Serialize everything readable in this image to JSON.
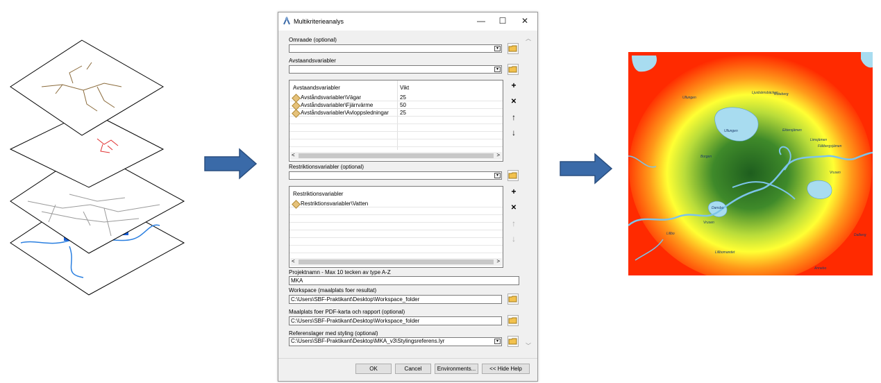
{
  "dialog": {
    "title": "Multikriterieanalys",
    "window_buttons": {
      "minimize": "—",
      "maximize": "☐",
      "close": "✕"
    },
    "omraade": {
      "label": "Omraade (optional)",
      "value": ""
    },
    "avstaand": {
      "label": "Avstaandsvariabler",
      "value": ""
    },
    "avstaand_table": {
      "headers": [
        "Avstaandsvariabler",
        "Vikt"
      ],
      "rows": [
        {
          "name": "Avståndsvariabler\\Vägar",
          "weight": "25"
        },
        {
          "name": "Avståndsvariabler\\Fjärrvärme",
          "weight": "50"
        },
        {
          "name": "Avståndsvariabler\\Avloppsledningar",
          "weight": "25"
        }
      ]
    },
    "restriktion": {
      "label": "Restriktionsvariabler (optional)",
      "value": ""
    },
    "restriktion_table": {
      "headers": [
        "Restriktionsvariabler"
      ],
      "rows": [
        {
          "name": "Restriktionsvariabler\\Vatten"
        }
      ]
    },
    "projektnamn": {
      "label": "Projektnamn - Max 10 tecken av type A-Z",
      "value": "MKA"
    },
    "workspace": {
      "label": "Workspace (maalplats foer resultat)",
      "value": "C:\\Users\\SBF-Praktikant\\Desktop\\Workspace_folder"
    },
    "pdf": {
      "label": "Maalplats foer PDF-karta och rapport (optional)",
      "value": "C:\\Users\\SBF-Praktikant\\Desktop\\Workspace_folder"
    },
    "referens": {
      "label": "Referenslager med styling (optional)",
      "value": "C:\\Users\\SBF-Praktikant\\Desktop\\MKA_v3\\Stylingsreferens.lyr"
    },
    "buttons": {
      "ok": "OK",
      "cancel": "Cancel",
      "environments": "Environments...",
      "hide_help": "<< Hide Help"
    },
    "side_buttons": {
      "add": "+",
      "remove": "✕",
      "up": "↑",
      "down": "↓"
    },
    "scroll": {
      "left": "<",
      "right": ">"
    }
  },
  "map_labels": {
    "ulluan": "Ullungen",
    "ljus": "Ljusbärnsbäcken",
    "borgen": "Borgen",
    "vrusen": "Vrusen",
    "dansbo": "Dansbo",
    "lillbo": "Lillbo",
    "lillbomandel": "Lillbomandet",
    "annebo": "Annebo",
    "dalberg": "Dalberg",
    "roteberg": "Roteberg",
    "falt": "Fältbergsjämen",
    "lim": "Limsjämen",
    "ekt": "Ektersjämen",
    "uppsala": "Ullungen",
    "vrusen2": "Vrusen"
  },
  "colors": {
    "map_red": "#ff2a00",
    "map_yellow": "#ffff33",
    "map_green": "#1e6e1e",
    "water": "#a8dcf0",
    "arrow_blue": "#3a6aa8"
  }
}
